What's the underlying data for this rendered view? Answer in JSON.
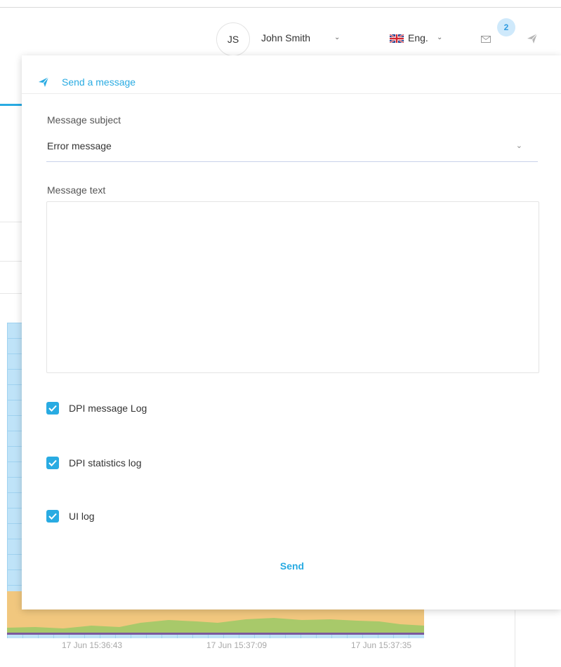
{
  "header": {
    "avatar_initials": "JS",
    "user_name": "John Smith",
    "language": "Eng.",
    "notification_count": "2",
    "icons": [
      "chevron-down-icon",
      "uk-flag-icon",
      "mail-icon",
      "paper-plane-icon"
    ]
  },
  "colors": {
    "accent": "#29abe2",
    "badge_bg": "#cfe9fb",
    "chart_blue": "#bfe3f8",
    "chart_orange": "#f1c77e",
    "chart_green": "#a8c96a",
    "chart_purple": "#7b5a9e"
  },
  "background_chart": {
    "x_ticks": [
      "17 Jun 15:36:43",
      "17 Jun 15:37:09",
      "17 Jun 15:37:35"
    ]
  },
  "panel": {
    "title": "Send a message",
    "subject_label": "Message subject",
    "subject_value": "Error message",
    "text_label": "Message text",
    "text_value": "",
    "checkboxes": [
      {
        "label": "DPI message Log",
        "checked": true
      },
      {
        "label": "DPI statistics log",
        "checked": true
      },
      {
        "label": "UI log",
        "checked": true
      }
    ],
    "send_label": "Send"
  }
}
